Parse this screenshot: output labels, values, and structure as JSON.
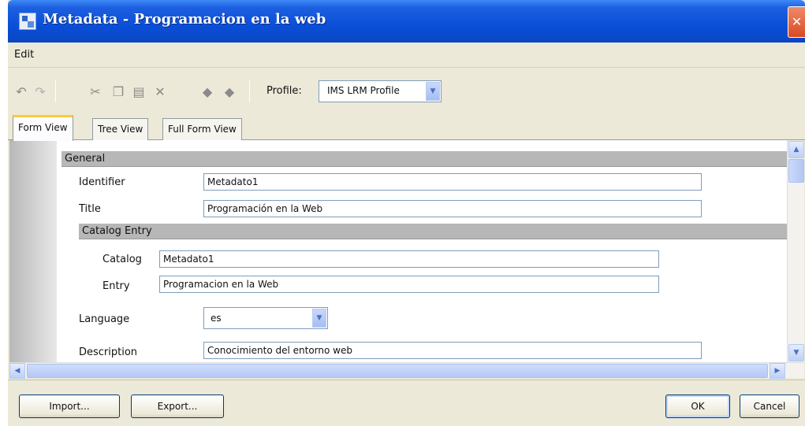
{
  "window": {
    "title": "Metadata - Programacion en la web",
    "close_glyph": "✕"
  },
  "menu": {
    "items": [
      "Edit"
    ]
  },
  "toolbar": {
    "icons": [
      "undo-icon",
      "redo-icon",
      "cut-icon",
      "copy-icon",
      "paste-icon",
      "delete-icon",
      "move-up-icon",
      "move-down-icon"
    ],
    "profile_label": "Profile:",
    "profile_value": "IMS LRM Profile"
  },
  "tabs": [
    {
      "label": "Form View",
      "active": true
    },
    {
      "label": "Tree View",
      "active": false
    },
    {
      "label": "Full Form View",
      "active": false
    }
  ],
  "form": {
    "general_header": "General",
    "identifier_label": "Identifier",
    "identifier_value": "Metadato1",
    "title_label": "Title",
    "title_value": "Programación en la Web",
    "catalog_entry_header": "Catalog Entry",
    "catalog_label": "Catalog",
    "catalog_value": "Metadato1",
    "entry_label": "Entry",
    "entry_value": "Programacion en la Web",
    "language_label": "Language",
    "language_value": "es",
    "description_label": "Description",
    "description_value": "Conocimiento del entorno web"
  },
  "footer": {
    "import_label": "Import...",
    "export_label": "Export...",
    "ok_label": "OK",
    "cancel_label": "Cancel"
  },
  "colors": {
    "titlebar": "#0a4fd8",
    "chrome": "#ece9d8",
    "group_header": "#b7b7b7",
    "scroll_accent": "#b4c8f5"
  }
}
